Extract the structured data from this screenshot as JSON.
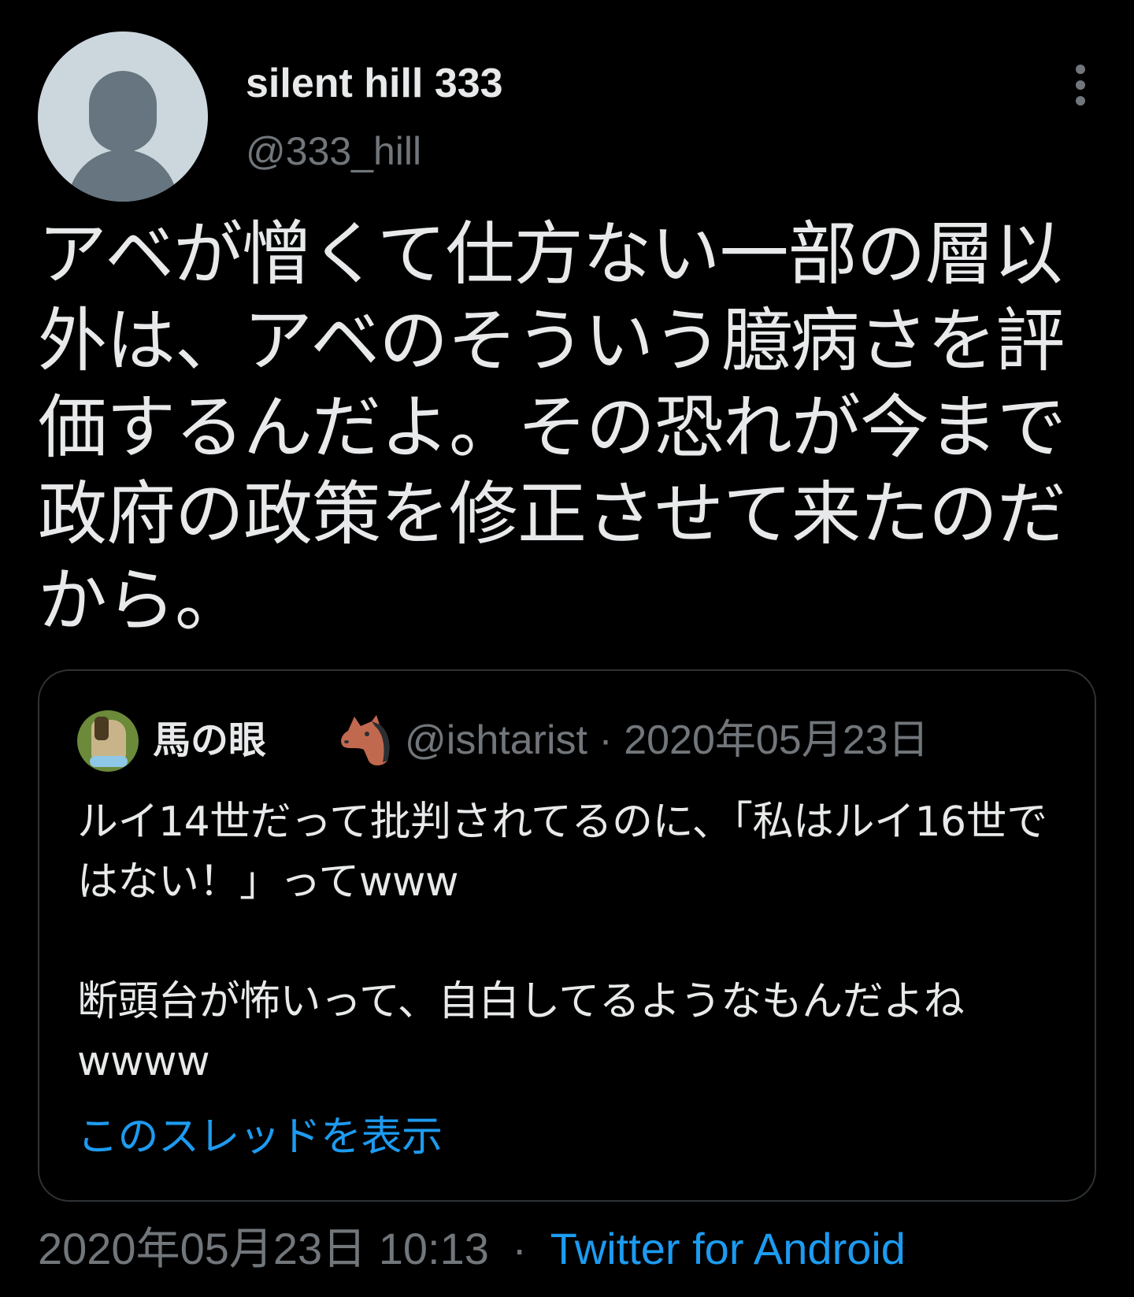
{
  "author": {
    "display_name": "silent hill 333",
    "handle": "@333_hill"
  },
  "tweet": {
    "text": "アベが憎くて仕方ない一部の層以外は、アベのそういう臆病さを評価するんだよ。その恐れが今まで政府の政策を修正させて来たのだから。"
  },
  "quoted_tweet": {
    "display_name": "馬の眼",
    "handle": "@ishtarist",
    "separator": "·",
    "date": "2020年05月23日",
    "text": "ルイ14世だって批判されてるのに、「私はルイ16世ではない！」ってwww\n\n断頭台が怖いって、自白してるようなもんだよねwwww",
    "show_thread_label": "このスレッドを表示"
  },
  "footer": {
    "timestamp": "2020年05月23日 10:13",
    "separator": "·",
    "source": "Twitter for Android"
  },
  "colors": {
    "background": "#000000",
    "primary_text": "#e7e9ea",
    "secondary_text": "#71767b",
    "link": "#1d9bf0",
    "border": "#2f3336"
  },
  "icons": {
    "avatar": "default-avatar-icon",
    "more": "more-options-icon",
    "horse": "horse-face-emoji-icon"
  }
}
